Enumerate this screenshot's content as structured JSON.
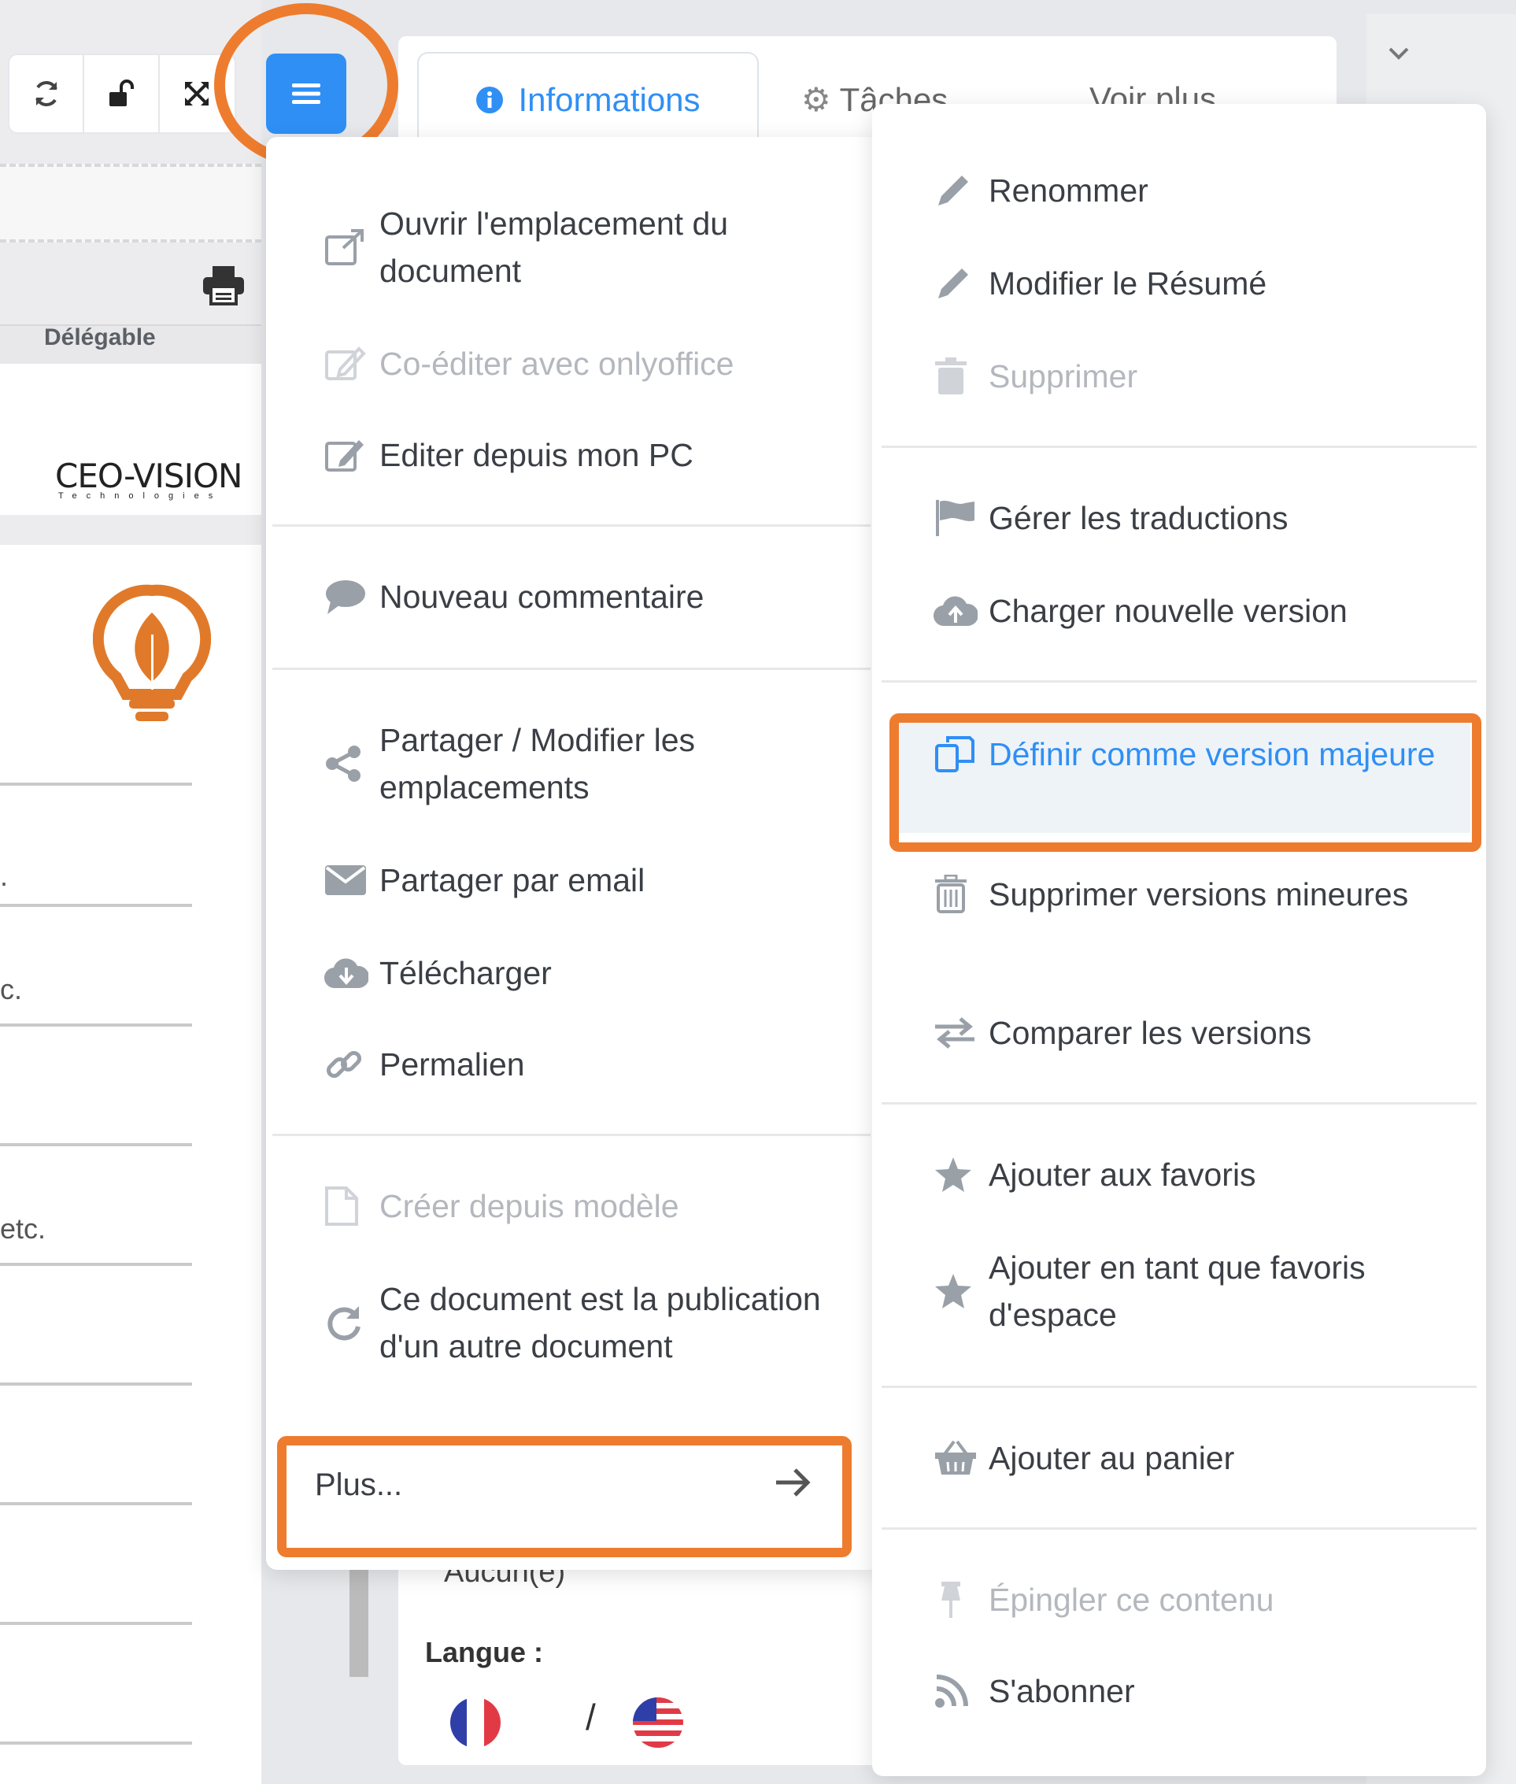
{
  "document_pane": {
    "column_label": "Délégable",
    "logo_text": "CEO-VISION",
    "logo_subtext": "Technologies",
    "fragments": [
      ".",
      "c.",
      "etc."
    ]
  },
  "tabs": {
    "informations": "Informations",
    "taches": "Tâches",
    "voir_plus": "Voir plus"
  },
  "details": {
    "value_aucun": "Aucun(e)",
    "langue_label": "Langue :",
    "langue_separator": "/"
  },
  "menu_left": {
    "items": [
      {
        "label": "Ouvrir l'emplacement du document",
        "icon": "external-link-icon",
        "enabled": true
      },
      {
        "label": "Co-éditer avec onlyoffice",
        "icon": "edit-icon",
        "enabled": false
      },
      {
        "label": "Editer depuis mon PC",
        "icon": "edit-icon",
        "enabled": true
      },
      {
        "label": "Nouveau commentaire",
        "icon": "comment-icon",
        "enabled": true
      },
      {
        "label": "Partager / Modifier les emplacements",
        "icon": "share-icon",
        "enabled": true
      },
      {
        "label": "Partager par email",
        "icon": "envelope-icon",
        "enabled": true
      },
      {
        "label": "Télécharger",
        "icon": "cloud-download-icon",
        "enabled": true
      },
      {
        "label": "Permalien",
        "icon": "link-icon",
        "enabled": true
      },
      {
        "label": "Créer depuis modèle",
        "icon": "file-icon",
        "enabled": false
      },
      {
        "label": "Ce document est la publication d'un autre document",
        "icon": "refresh-icon",
        "enabled": true
      }
    ],
    "more_label": "Plus..."
  },
  "menu_right": {
    "items": [
      {
        "label": "Renommer",
        "icon": "pencil-icon",
        "enabled": true
      },
      {
        "label": "Modifier le Résumé",
        "icon": "pencil-icon",
        "enabled": true
      },
      {
        "label": "Supprimer",
        "icon": "trash-icon",
        "enabled": false
      },
      {
        "label": "Gérer les traductions",
        "icon": "flag-icon",
        "enabled": true
      },
      {
        "label": "Charger nouvelle version",
        "icon": "cloud-upload-icon",
        "enabled": true
      },
      {
        "label": "Définir comme version majeure",
        "icon": "copy-icon",
        "enabled": true,
        "highlighted": true
      },
      {
        "label": "Supprimer versions mineures",
        "icon": "trash-icon",
        "enabled": true
      },
      {
        "label": "Comparer les versions",
        "icon": "exchange-icon",
        "enabled": true
      },
      {
        "label": "Ajouter aux favoris",
        "icon": "star-icon",
        "enabled": true
      },
      {
        "label": "Ajouter en tant que favoris d'espace",
        "icon": "star-icon",
        "enabled": true
      },
      {
        "label": "Ajouter au panier",
        "icon": "basket-icon",
        "enabled": true
      },
      {
        "label": "Épingler ce contenu",
        "icon": "pin-icon",
        "enabled": false
      },
      {
        "label": "S'abonner",
        "icon": "rss-icon",
        "enabled": true
      }
    ]
  },
  "colors": {
    "accent_blue": "#2f8ff5",
    "annotation_orange": "#ee7c2e",
    "highlight_bg": "#eef3f8",
    "disabled_text": "#b4b8be"
  }
}
